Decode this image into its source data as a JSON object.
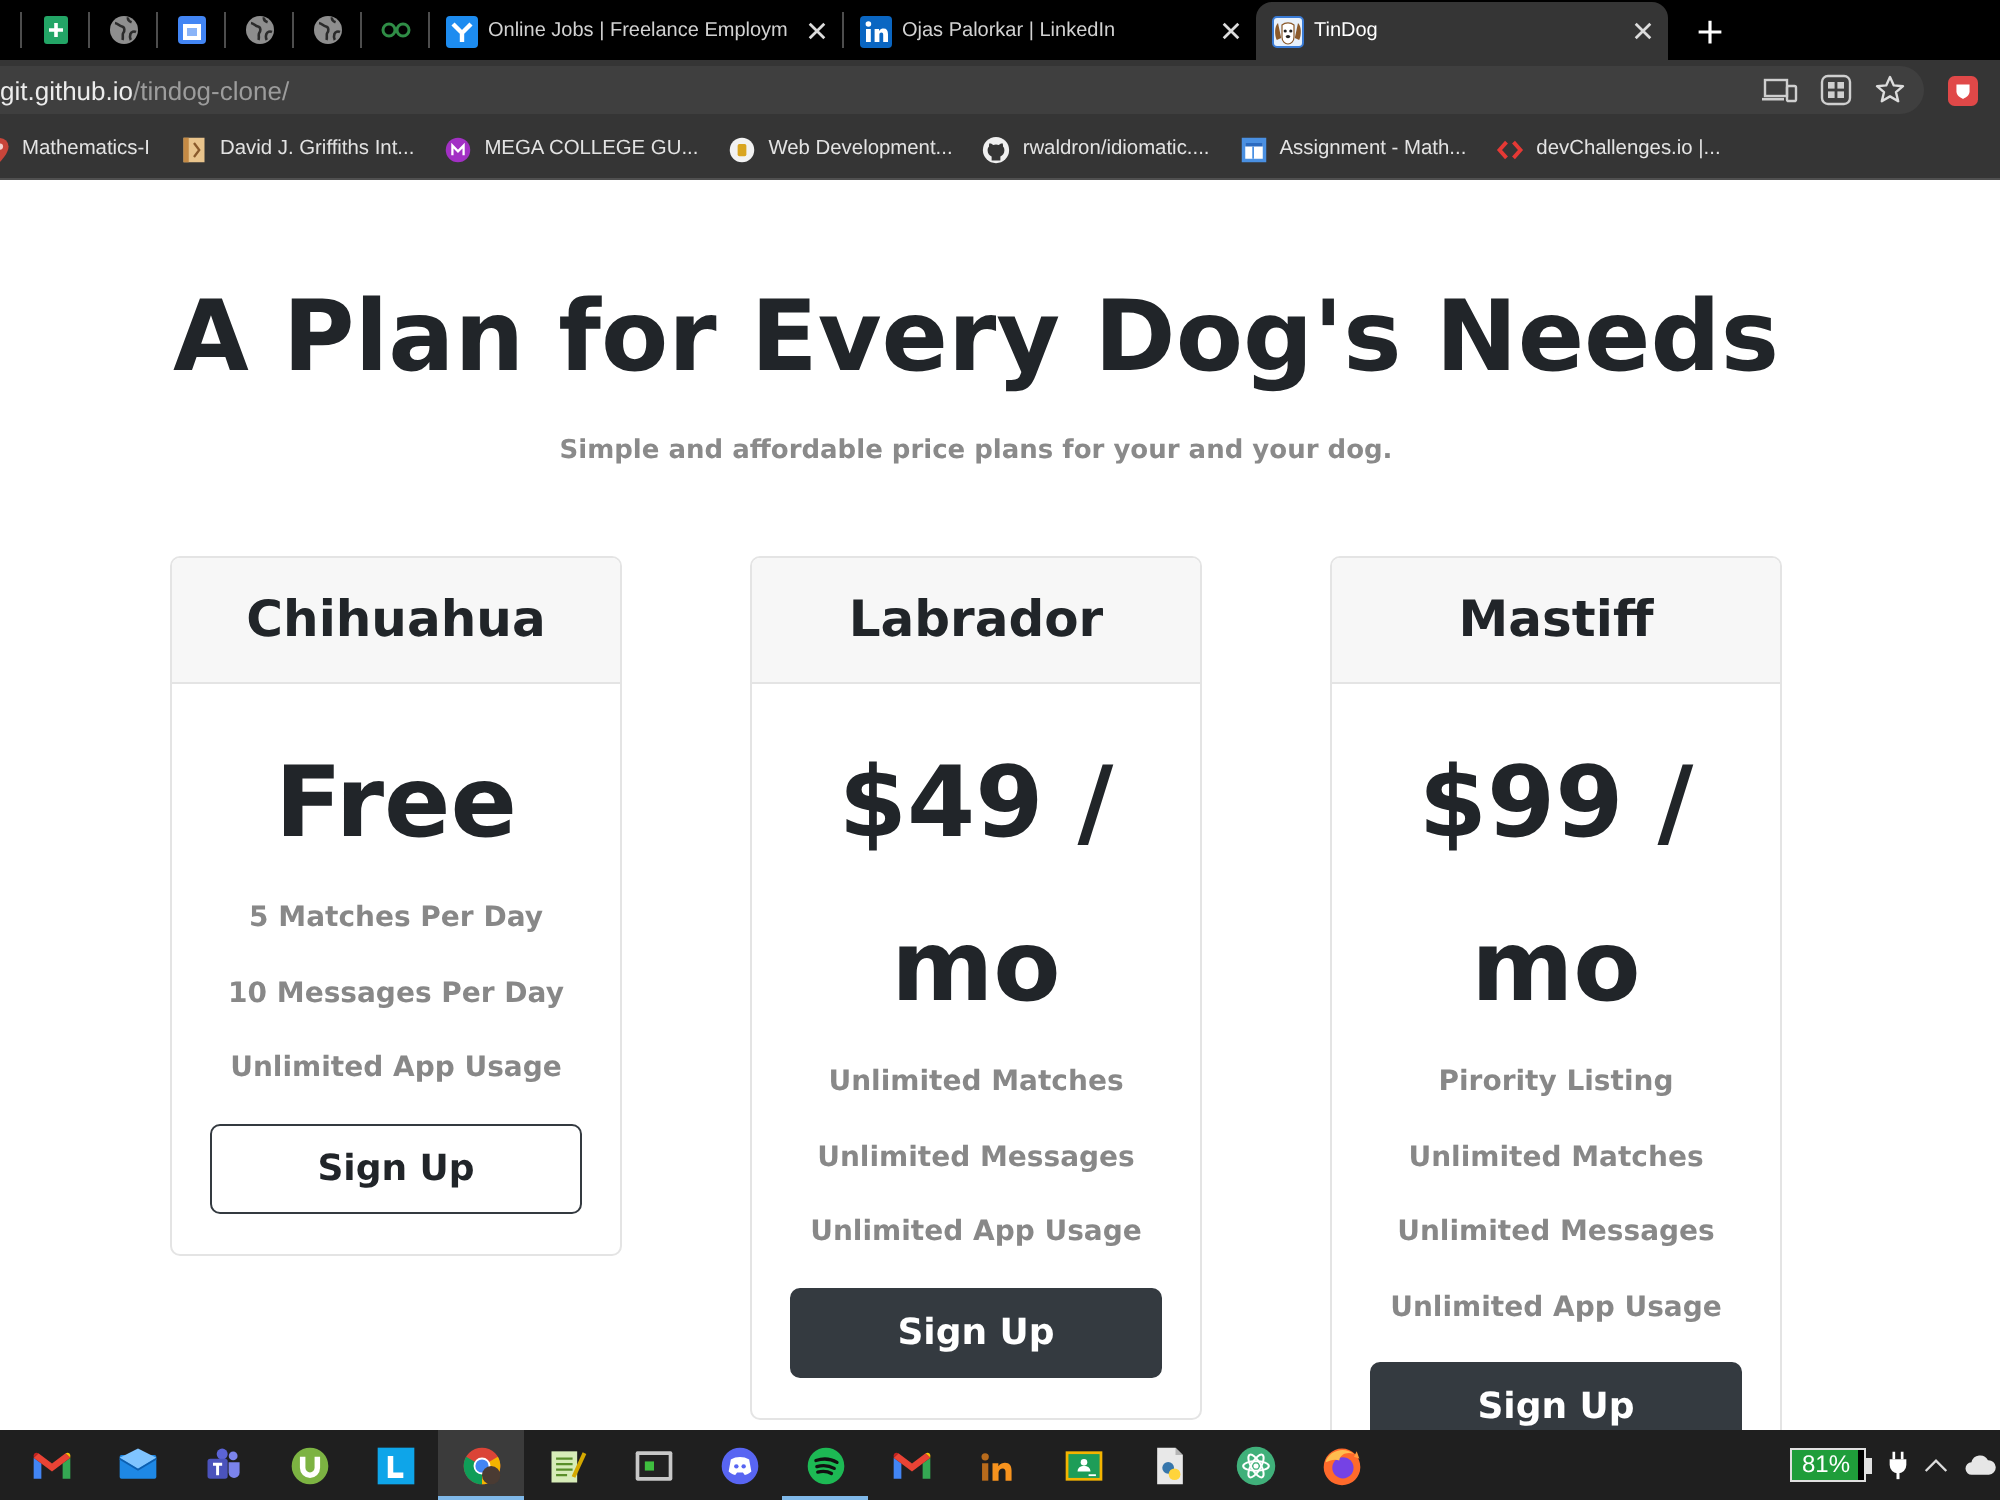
{
  "browser": {
    "pinned_tabs": [
      {
        "kind": "sheet"
      },
      {
        "kind": "globe"
      },
      {
        "kind": "calendar"
      },
      {
        "kind": "globe"
      },
      {
        "kind": "globe"
      },
      {
        "kind": "glasses"
      }
    ],
    "tabs": [
      {
        "title": "Online Jobs | Freelance Employm",
        "kind": "bird",
        "selected": false
      },
      {
        "title": "Ojas Palorkar | LinkedIn",
        "kind": "in",
        "selected": false
      },
      {
        "title": "TinDog",
        "kind": "dog",
        "selected": true
      }
    ],
    "address_bar": {
      "host": "git.github.io",
      "path": "/tindog-clone/"
    },
    "bookmarks": [
      {
        "label": "Mathematics-I",
        "kind": "pin"
      },
      {
        "label": "David J. Griffiths Int...",
        "kind": "book"
      },
      {
        "label": "MEGA COLLEGE GU...",
        "kind": "mbadge"
      },
      {
        "label": "Web Development...",
        "kind": "coin"
      },
      {
        "label": "rwaldron/idiomatic....",
        "kind": "cat"
      },
      {
        "label": "Assignment - Math...",
        "kind": "doc"
      },
      {
        "label": "devChallenges.io |...",
        "kind": "code"
      }
    ]
  },
  "page": {
    "title": "A Plan for Every Dog's Needs",
    "subtitle": "Simple and affordable price plans for your and your dog.",
    "plans": [
      {
        "name": "Chihuahua",
        "price": "Free",
        "features": [
          "5 Matches Per Day",
          "10 Messages Per Day",
          "Unlimited App Usage"
        ],
        "button": {
          "label": "Sign Up",
          "kind": "outline"
        }
      },
      {
        "name": "Labrador",
        "price": "$49 / mo",
        "features": [
          "Unlimited Matches",
          "Unlimited Messages",
          "Unlimited App Usage"
        ],
        "button": {
          "label": "Sign Up",
          "kind": "solid"
        }
      },
      {
        "name": "Mastiff",
        "price": "$99 / mo",
        "features": [
          "Pirority Listing",
          "Unlimited Matches",
          "Unlimited Messages",
          "Unlimited App Usage"
        ],
        "button": {
          "label": "Sign Up",
          "kind": "solid"
        }
      }
    ]
  },
  "taskbar": {
    "apps": [
      {
        "kind": "mlogo",
        "active": false,
        "running": false
      },
      {
        "kind": "envelope",
        "active": false,
        "running": false
      },
      {
        "kind": "people",
        "active": false,
        "running": false
      },
      {
        "kind": "ucircle",
        "active": false,
        "running": false
      },
      {
        "kind": "ltile",
        "active": false,
        "running": false
      },
      {
        "kind": "wheel",
        "active": true,
        "running": true
      },
      {
        "kind": "notepad",
        "active": false,
        "running": false
      },
      {
        "kind": "terminal",
        "active": false,
        "running": false
      },
      {
        "kind": "gamepad",
        "active": false,
        "running": false
      },
      {
        "kind": "waves",
        "active": false,
        "running": true
      },
      {
        "kind": "mlogo",
        "active": false,
        "running": false
      },
      {
        "kind": "inlogo",
        "active": false,
        "running": false
      },
      {
        "kind": "board",
        "active": false,
        "running": false
      },
      {
        "kind": "script",
        "active": false,
        "running": false
      },
      {
        "kind": "atom",
        "active": false,
        "running": false
      },
      {
        "kind": "flame",
        "active": false,
        "running": false
      }
    ],
    "battery": "81%"
  }
}
